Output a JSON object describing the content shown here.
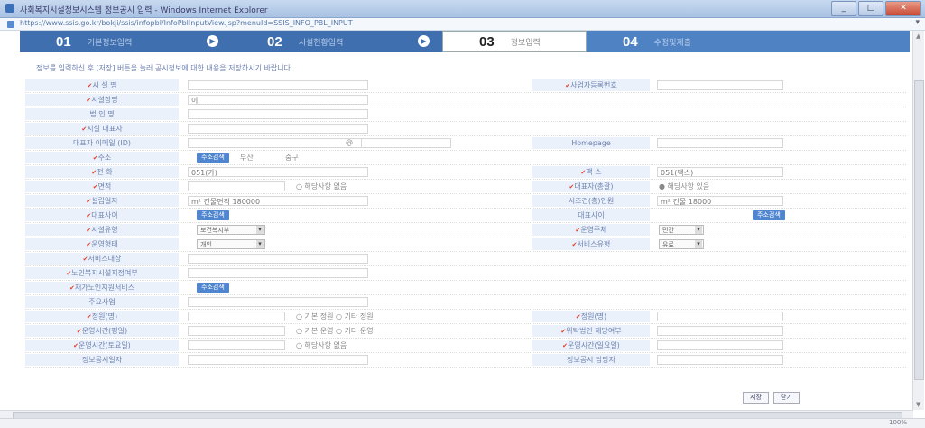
{
  "window": {
    "title": "사회복지시설정보시스템 정보공시 입력 - Windows Internet Explorer",
    "url": "https://www.ssis.go.kr/bokji/ssis/infopbl/InfoPblInputView.jsp?menuId=SSIS_INFO_PBL_INPUT",
    "minimize_label": "_",
    "maximize_label": "□",
    "close_label": "✕"
  },
  "steps": [
    {
      "num": "01",
      "label": "기본정보입력"
    },
    {
      "num": "02",
      "label": "시설현황입력"
    },
    {
      "num": "03",
      "label": "정보입력"
    },
    {
      "num": "04",
      "label": "수정및제출"
    }
  ],
  "notice": "정보를 입력하신 후 [저장] 버튼을 눌러 공시정보에 대한 내용을 저장하시기 바랍니다.",
  "form": {
    "rows": [
      {
        "label": "시 설 명",
        "req": true,
        "label2": "사업자등록번호",
        "req2": true
      },
      {
        "label": "시설장명",
        "req": true,
        "v1": "이"
      },
      {
        "label": "법 인 명",
        "req": false
      },
      {
        "label": "시설 대표자",
        "req": true
      },
      {
        "label": "대표자 이메일 (ID)",
        "req": false,
        "sep": "@",
        "label2": "Homepage",
        "req2": false
      },
      {
        "label": "주소",
        "req": true,
        "btn": "주소검색",
        "v1": "부산",
        "v2": "중구"
      },
      {
        "label": "전 화",
        "req": true,
        "v1": "051(가)",
        "label2": "팩 스",
        "req2": true,
        "v2": "051(팩스)"
      },
      {
        "label": "면적",
        "req": true,
        "radio1": "○ 해당사항 없음",
        "label2": "대표자(총괄)",
        "req2": true,
        "radio2": "● 해당사항 있음"
      },
      {
        "label": "설립일자",
        "req": true,
        "v1": "m² 건물면적 180000",
        "label2": "시조건(총)인원",
        "req2": false,
        "v2": "m² 건물 18000"
      },
      {
        "label": "대표사이",
        "req": true,
        "btn": "주소검색",
        "label2": "대표사이",
        "req2": false,
        "btn2": "주소검색"
      },
      {
        "label": "시설유형",
        "req": true,
        "sel1": "보건복지부",
        "label2": "운영주체",
        "req2": true,
        "sel2": "민간"
      },
      {
        "label": "운영형태",
        "req": true,
        "sel1": "개인",
        "label2": "서비스유형",
        "req2": true,
        "sel2": "유료"
      },
      {
        "label": "서비스대상",
        "req": true
      },
      {
        "label": "노인복지시설지정여부",
        "req": true
      },
      {
        "label": "재가노인지원서비스",
        "req": true,
        "btn": "주소검색"
      },
      {
        "label": "주요사업",
        "req": false
      },
      {
        "label": "정원(명)",
        "req": true,
        "radio1": "○ 기본 정원  ○ 기타 정원",
        "label2": "정원(명)",
        "req2": true
      },
      {
        "label": "운영시간(평일)",
        "req": true,
        "radio1": "○ 기본 운영  ○ 기타 운영",
        "label2": "위탁법인 해당여부",
        "req2": true
      },
      {
        "label": "운영시간(토요일)",
        "req": true,
        "radio1": "○ 해당사항 없음",
        "label2": "운영시간(일요일)",
        "req2": true
      },
      {
        "label": "정보공시일자",
        "req": false,
        "label2": "정보공시 담당자",
        "req2": false
      }
    ]
  },
  "buttons": {
    "save": "저장",
    "cancel": "닫기"
  },
  "status": {
    "zoom": "100%"
  },
  "colors": {
    "step_bg": "#3f6fae",
    "label_bg": "#eaf1fb",
    "required_mark": "#e0402a"
  }
}
